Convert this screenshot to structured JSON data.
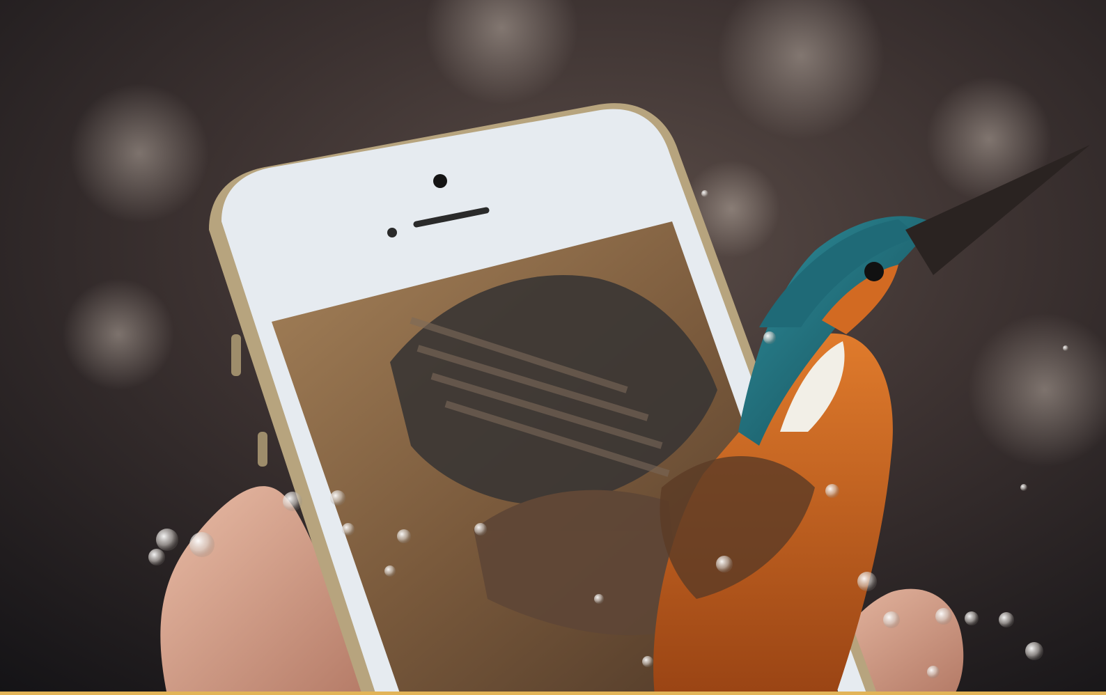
{
  "scene": {
    "subjects": [
      "hand-icon",
      "smartphone-icon",
      "kingfisher-icon",
      "water-droplet-icon"
    ],
    "colors": {
      "background_dark": "#1c1a1c",
      "background_warm": "#3b3130",
      "bokeh_light": "#8a8079",
      "phone_body": "#e6ebf0",
      "phone_bezel": "#d3dbe3",
      "phone_edge": "#b7a47e",
      "screen_brown": "#7a5a3c",
      "wing_dark": "#3a3634",
      "kingfisher_teal": "#1f6a77",
      "kingfisher_orange": "#c9631d",
      "kingfisher_white": "#f2efe7",
      "beak_dark": "#2a2321",
      "skin": "#d8a48e",
      "bottom_line": "#e2b458"
    }
  }
}
